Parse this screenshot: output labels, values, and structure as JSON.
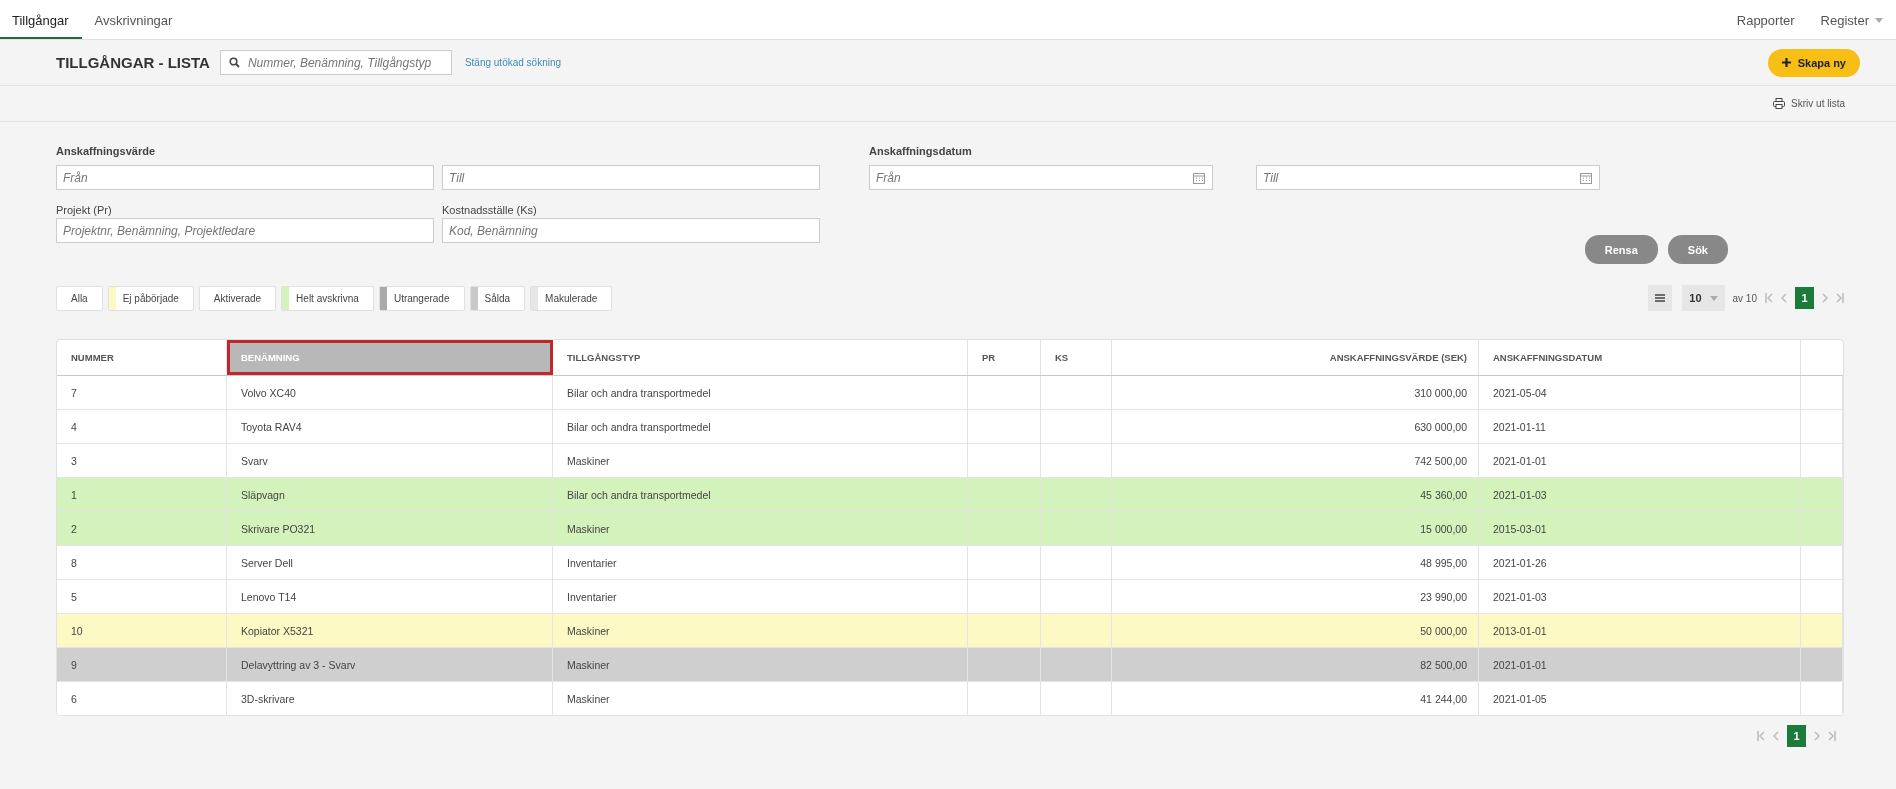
{
  "nav": {
    "tabs": [
      {
        "label": "Tillgångar",
        "selected": true
      },
      {
        "label": "Avskrivningar",
        "selected": false
      }
    ],
    "right": [
      {
        "label": "Rapporter",
        "dropdown": false
      },
      {
        "label": "Register",
        "dropdown": true
      }
    ]
  },
  "header": {
    "title": "TILLGÅNGAR - LISTA",
    "search_placeholder": "Nummer, Benämning, Tillgångstyp",
    "toggle_link": "Stäng utökad sökning",
    "create_button": "Skapa ny"
  },
  "print_link": "Skriv ut lista",
  "filters": {
    "value": {
      "label": "Anskaffningsvärde",
      "from_placeholder": "Från",
      "to_placeholder": "Till"
    },
    "date": {
      "label": "Anskaffningsdatum",
      "from_placeholder": "Från",
      "to_placeholder": "Till"
    },
    "project": {
      "label": "Projekt (Pr)",
      "placeholder": "Projektnr, Benämning, Projektledare"
    },
    "cost_center": {
      "label": "Kostnadsställe (Ks)",
      "placeholder": "Kod, Benämning"
    },
    "buttons": [
      "Rensa",
      "Sök"
    ]
  },
  "status_chips": [
    {
      "label": "Alla"
    },
    {
      "label": "Ej påbörjade",
      "color": "#fdf9c4"
    },
    {
      "label": "Aktiverade"
    },
    {
      "label": "Helt avskrivna",
      "color": "#d4f2bb"
    },
    {
      "label": "Utrangerade",
      "color": "#a9a9a9"
    },
    {
      "label": "Sålda",
      "color": "#c8c8c8"
    },
    {
      "label": "Makulerade",
      "color": "#e6e6e6"
    }
  ],
  "pagination": {
    "page_size": "10",
    "total": "av 10",
    "pages": [
      {
        "label": "1",
        "selected": true
      }
    ]
  },
  "table": {
    "columns": [
      {
        "label": "NUMMER",
        "selected": false
      },
      {
        "label": "BENÄMNING",
        "selected": true
      },
      {
        "label": "TILLGÅNGSTYP",
        "selected": false
      },
      {
        "label": "PR",
        "selected": false
      },
      {
        "label": "KS",
        "selected": false
      },
      {
        "label": "ANSKAFFNINGSVÄRDE (SEK)",
        "selected": false
      },
      {
        "label": "ANSKAFFNINGSDATUM",
        "selected": false
      }
    ],
    "rows": [
      {
        "cells": [
          "7",
          "Volvo XC40",
          "Bilar och andra transportmedel",
          "",
          "",
          "310 000,00",
          "2021-05-04"
        ]
      },
      {
        "cells": [
          "4",
          "Toyota RAV4",
          "Bilar och andra transportmedel",
          "",
          "",
          "630 000,00",
          "2021-01-11"
        ]
      },
      {
        "cells": [
          "3",
          "Svarv",
          "Maskiner",
          "",
          "",
          "742 500,00",
          "2021-01-01"
        ]
      },
      {
        "cells": [
          "1",
          "Släpvagn",
          "Bilar och andra transportmedel",
          "",
          "",
          "45 360,00",
          "2021-01-03"
        ],
        "color": "#d4f2bb"
      },
      {
        "cells": [
          "2",
          "Skrivare PO321",
          "Maskiner",
          "",
          "",
          "15 000,00",
          "2015-03-01"
        ],
        "color": "#d4f2bb"
      },
      {
        "cells": [
          "8",
          "Server Dell",
          "Inventarier",
          "",
          "",
          "48 995,00",
          "2021-01-26"
        ]
      },
      {
        "cells": [
          "5",
          "Lenovo T14",
          "Inventarier",
          "",
          "",
          "23 990,00",
          "2021-01-03"
        ]
      },
      {
        "cells": [
          "10",
          "Kopiator X5321",
          "Maskiner",
          "",
          "",
          "50 000,00",
          "2013-01-01"
        ],
        "color": "#fdf9c4"
      },
      {
        "cells": [
          "9",
          "Delavyttring av 3 - Svarv",
          "Maskiner",
          "",
          "",
          "82 500,00",
          "2021-01-01"
        ],
        "color": "#cfcfcf"
      },
      {
        "cells": [
          "6",
          "3D-skrivare",
          "Maskiner",
          "",
          "",
          "41 244,00",
          "2021-01-05"
        ]
      }
    ]
  },
  "bottom_pagination": {
    "pages": [
      {
        "label": "1",
        "selected": true
      }
    ]
  }
}
